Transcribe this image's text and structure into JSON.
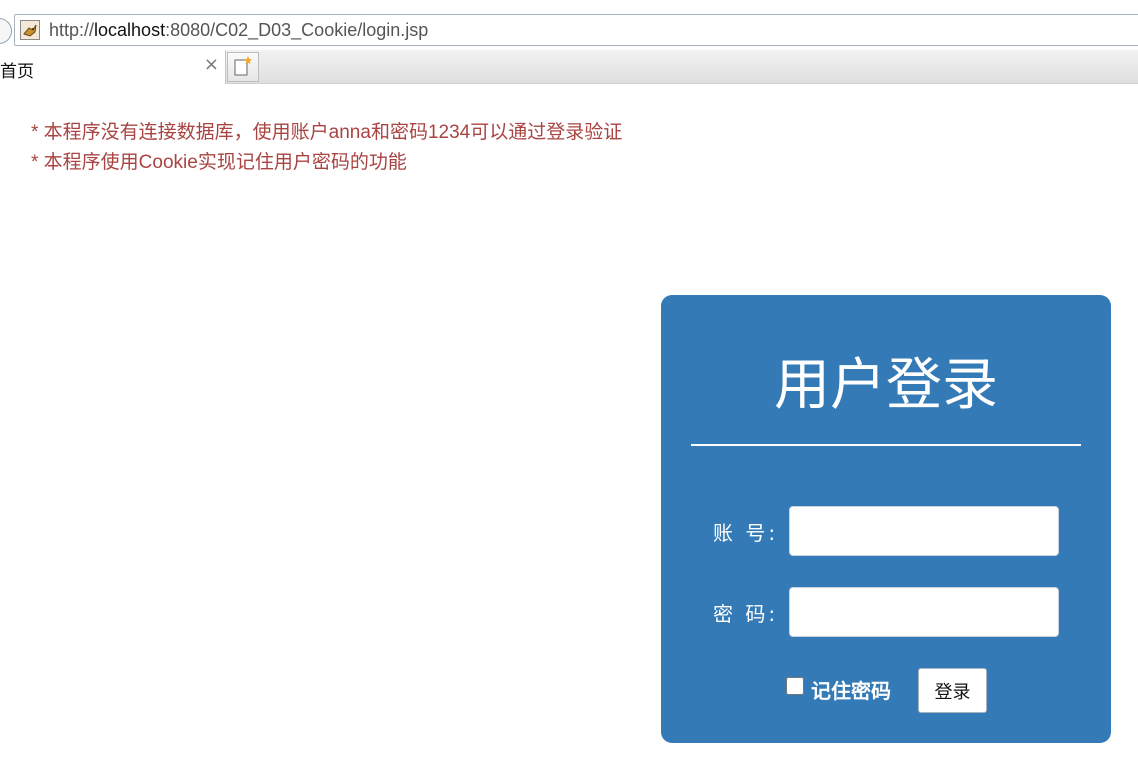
{
  "browser": {
    "url_prefix": "http://",
    "url_host": "localhost",
    "url_rest": ":8080/C02_D03_Cookie/login.jsp",
    "tab_title": "首页",
    "tab_close": "×"
  },
  "notes": [
    "* 本程序没有连接数据库，使用账户anna和密码1234可以通过登录验证",
    "* 本程序使用Cookie实现记住用户密码的功能"
  ],
  "login": {
    "title": "用户登录",
    "account_label": "账 号:",
    "account_value": "",
    "password_label": "密 码:",
    "password_value": "",
    "remember_label": "记住密码",
    "remember_checked": false,
    "submit_label": "登录"
  },
  "colors": {
    "panel": "#337ab7",
    "notice": "#a94442"
  },
  "icons": {
    "favicon": "tomcat-favicon-icon",
    "close": "close-icon",
    "new_tab": "new-tab-icon"
  }
}
